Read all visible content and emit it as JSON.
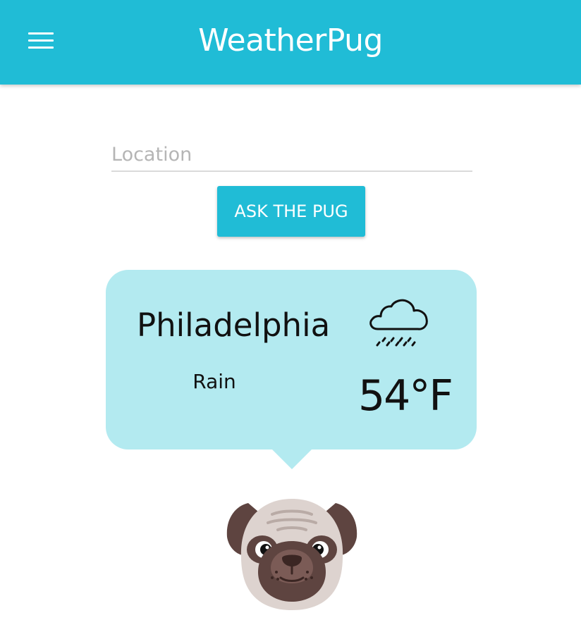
{
  "app": {
    "title": "WeatherPug"
  },
  "search": {
    "placeholder": "Location",
    "value": "",
    "button_label": "ASK THE PUG"
  },
  "weather": {
    "city": "Philadelphia",
    "condition": "Rain",
    "temperature": "54°F",
    "icon": "cloud-rain-icon"
  },
  "colors": {
    "primary": "#20bcd6",
    "bubble": "#b3eaf0",
    "text": "#111111"
  },
  "icons": {
    "menu": "hamburger-menu-icon",
    "mascot": "pug-icon"
  }
}
